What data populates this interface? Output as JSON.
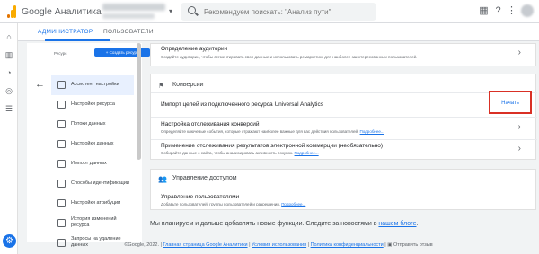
{
  "app": {
    "name": "Google Аналитика"
  },
  "search": {
    "placeholder": "Рекомендуем поискать: \"Анализ пути\""
  },
  "tabs": [
    {
      "label": "АДМИНИСТРАТОР"
    },
    {
      "label": "ПОЛЬЗОВАТЕЛИ"
    }
  ],
  "sidebar": {
    "resource_label": "Ресурс",
    "create_button": "+ Создать ресурс",
    "items": [
      {
        "label": "Ассистент настройки"
      },
      {
        "label": "Настройки ресурса"
      },
      {
        "label": "Потоки данных"
      },
      {
        "label": "Настройки данных"
      },
      {
        "label": "Импорт данных"
      },
      {
        "label": "Способы идентификации"
      },
      {
        "label": "Настройки атрибуции"
      },
      {
        "label": "История изменений ресурса"
      },
      {
        "label": "Запросы на удаление данных"
      }
    ]
  },
  "audience": {
    "title": "Определение аудитории",
    "desc": "Создайте аудитории, чтобы сегментировать свои данные и использовать ремаркетинг для наиболее заинтересованных пользователей."
  },
  "conversions": {
    "title": "Конверсии",
    "rows": [
      {
        "title": "Импорт целей из подключенного ресурса Universal Analytics",
        "action": "Начать"
      },
      {
        "title": "Настройка отслеживания конверсий",
        "desc": "Определяйте ключевые события, которые отражают наиболее важные для вас действия пользователей.",
        "link": "Подробнее..."
      },
      {
        "title": "Применение отслеживания результатов электронной коммерции (необязательно)",
        "desc": "Собирайте данные с сайта, чтобы анализировать активность покупок.",
        "link": "Подробнее..."
      }
    ]
  },
  "access": {
    "title": "Управление доступом",
    "row": {
      "title": "Управление пользователями",
      "desc": "Добавьте пользователей, группы пользователей и разрешения.",
      "link": "Подробнее..."
    }
  },
  "future": {
    "text": "Мы планируем и дальше добавлять новые функции. Следите за новостями в",
    "link": "нашем блоге",
    "end": "."
  },
  "footer": {
    "copyright": "©Google, 2022.",
    "links": [
      "Главная страница Google Аналитики",
      "Условия использования",
      "Политика конфиденциальности"
    ],
    "feedback": "Отправить отзыв"
  },
  "colors": {
    "accent": "#1a73e8",
    "highlight": "#d93025"
  },
  "icons": [
    "search-icon",
    "apps-icon",
    "help-icon",
    "more-vert-icon",
    "home-icon",
    "reports-icon",
    "explore-icon",
    "advertising-icon",
    "configure-icon",
    "settings-icon",
    "back-arrow-icon",
    "chevron-right-icon",
    "conversions-icon",
    "people-icon",
    "feedback-icon"
  ]
}
